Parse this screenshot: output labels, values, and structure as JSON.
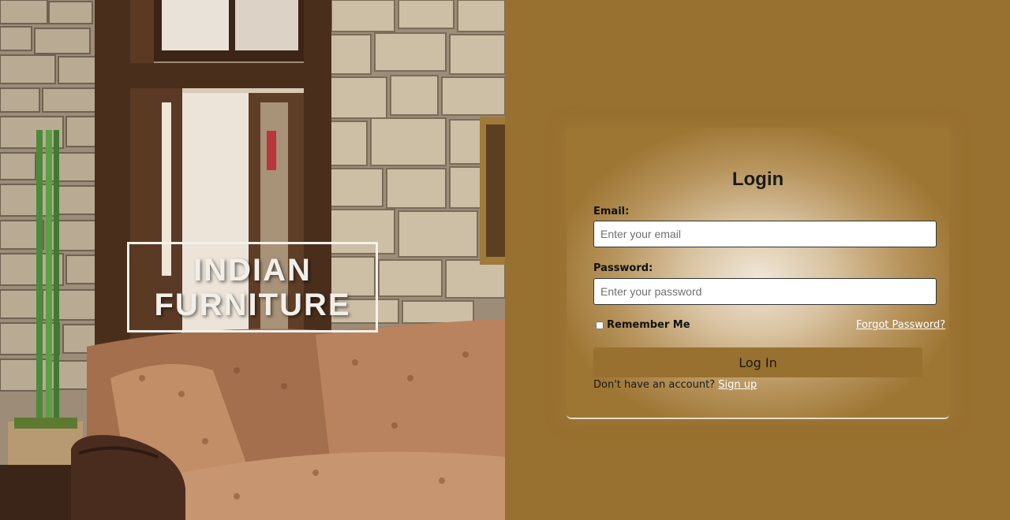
{
  "brand": {
    "line1": "INDIAN",
    "line2": "FURNITURE"
  },
  "login": {
    "title": "Login",
    "email_label": "Email:",
    "email_placeholder": "Enter your email",
    "password_label": "Password:",
    "password_placeholder": "Enter your password",
    "remember_label": "Remember Me",
    "forgot_link": "Forgot Password?",
    "submit_label": "Log In",
    "signup_prompt": "Don't have an account?",
    "signup_link": "Sign up"
  },
  "colors": {
    "background": "#98702f",
    "button": "#98702f"
  }
}
